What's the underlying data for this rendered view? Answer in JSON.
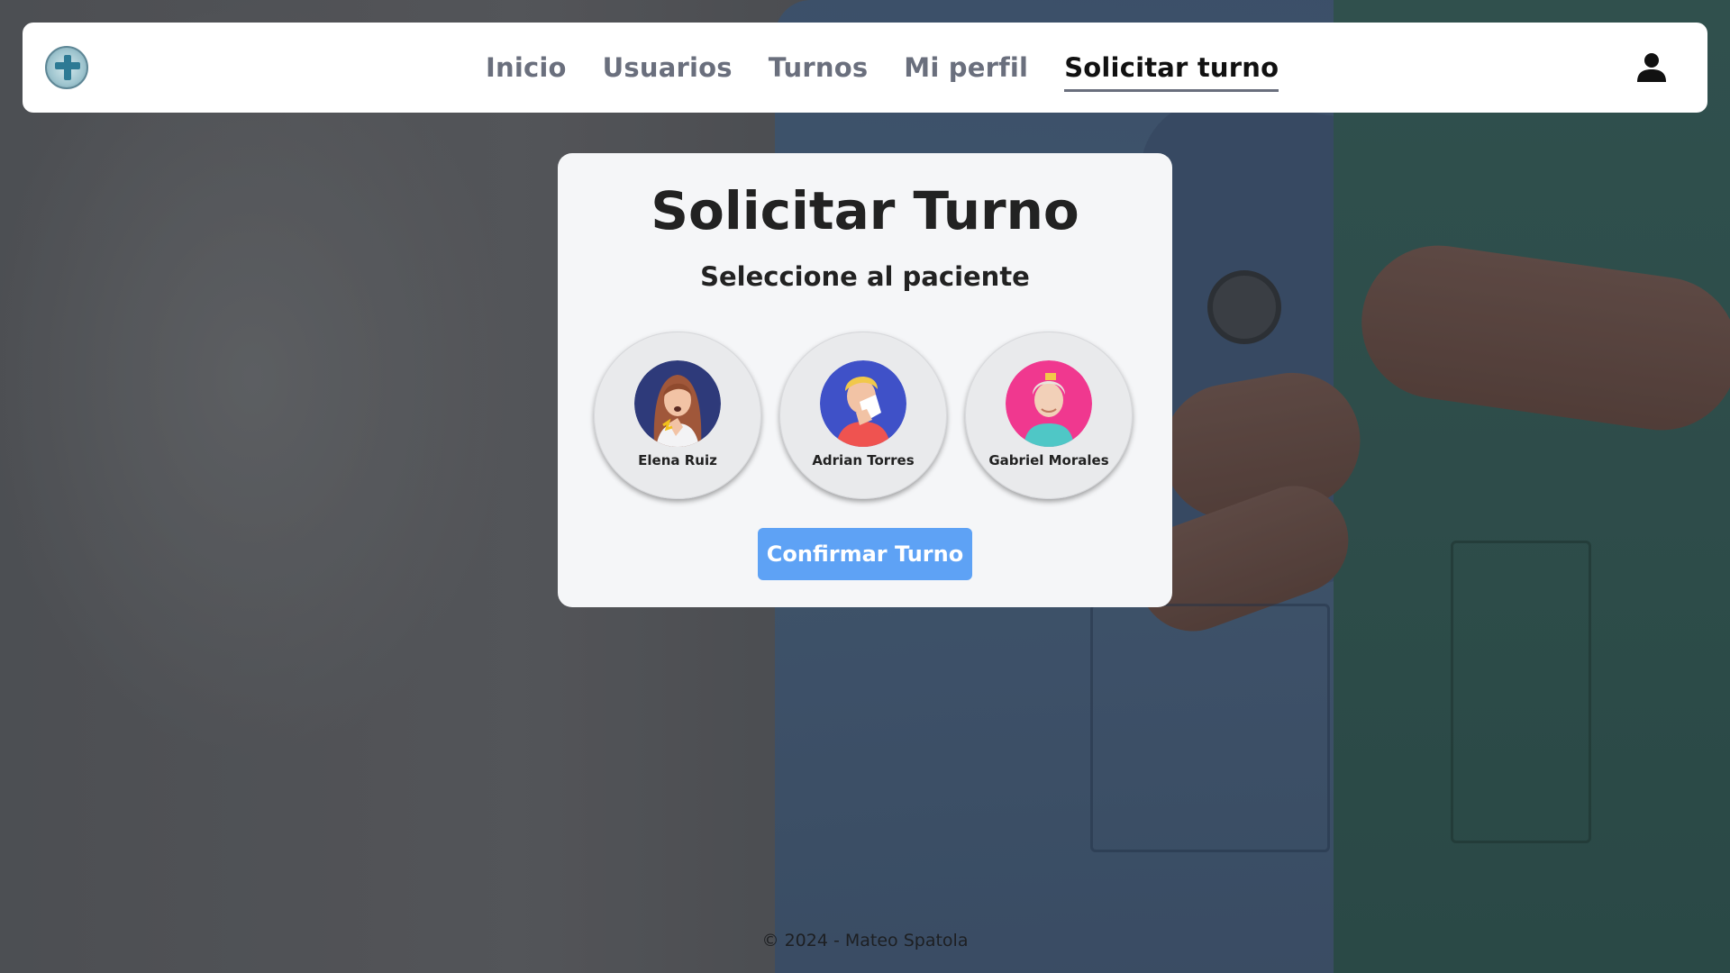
{
  "nav": {
    "logo_icon": "medical-cross-logo-icon",
    "links": [
      {
        "label": "Inicio",
        "active": false
      },
      {
        "label": "Usuarios",
        "active": false
      },
      {
        "label": "Turnos",
        "active": false
      },
      {
        "label": "Mi perfil",
        "active": false
      },
      {
        "label": "Solicitar turno",
        "active": true
      }
    ],
    "user_icon": "user-icon"
  },
  "card": {
    "title": "Solicitar Turno",
    "subtitle": "Seleccione al paciente",
    "patients": [
      {
        "name": "Elena Ruiz",
        "avatar_bg": "#2e3a7a",
        "icon": "patient-coughing-avatar-icon"
      },
      {
        "name": "Adrian Torres",
        "avatar_bg": "#3f51c8",
        "icon": "patient-sneezing-avatar-icon"
      },
      {
        "name": "Gabriel Morales",
        "avatar_bg": "#f0388f",
        "icon": "patient-elderly-avatar-icon"
      }
    ],
    "confirm_label": "Confirmar Turno"
  },
  "footer": {
    "text": "© 2024 - Mateo Spatola"
  },
  "colors": {
    "accent": "#5ea2f5",
    "nav_active": "#111111",
    "nav_inactive": "#6a6f7d"
  }
}
